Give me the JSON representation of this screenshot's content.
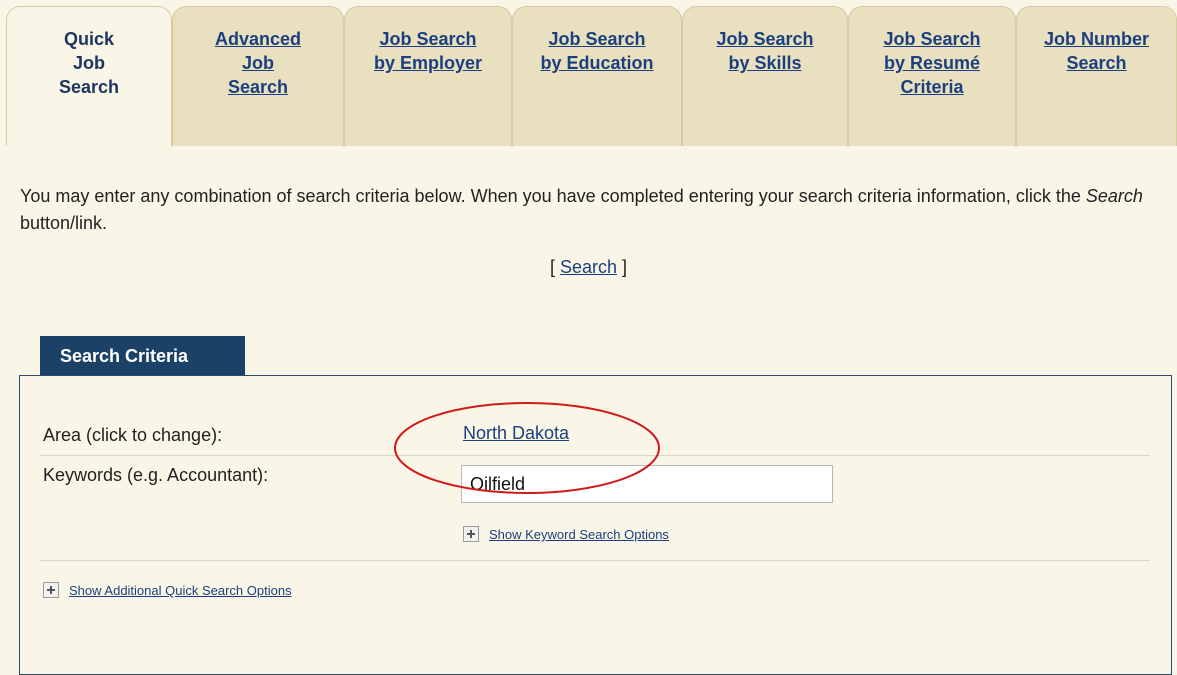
{
  "tabs": [
    {
      "label": "Quick\nJob\nSearch",
      "active": true
    },
    {
      "label": "Advanced\nJob\nSearch",
      "active": false
    },
    {
      "label": "Job Search\nby Employer",
      "active": false
    },
    {
      "label": "Job Search\nby Education",
      "active": false
    },
    {
      "label": "Job Search\nby Skills",
      "active": false
    },
    {
      "label": "Job Search\nby Resumé\nCriteria",
      "active": false
    },
    {
      "label": "Job Number\nSearch",
      "active": false
    }
  ],
  "intro": {
    "text_before": "You may enter any combination of search criteria below. When you have completed entering your search criteria information, click the ",
    "emphasis": "Search",
    "text_after": " button/link."
  },
  "search_link": {
    "open_bracket": "[",
    "label": "Search",
    "close_bracket": "]"
  },
  "panel": {
    "title": "Search Criteria",
    "area_label": "Area (click to change):",
    "area_value": "North Dakota",
    "keywords_label": "Keywords (e.g. Accountant):",
    "keywords_value": "Oilfield",
    "keyword_options_link": "Show Keyword Search Options",
    "additional_options_link": "Show Additional Quick Search Options"
  },
  "colors": {
    "background": "#f9f6e7",
    "tab_inactive": "#e8e0bf",
    "link": "#1c3f80",
    "panel_header": "#1c4166",
    "highlight": "#d11a1a"
  }
}
